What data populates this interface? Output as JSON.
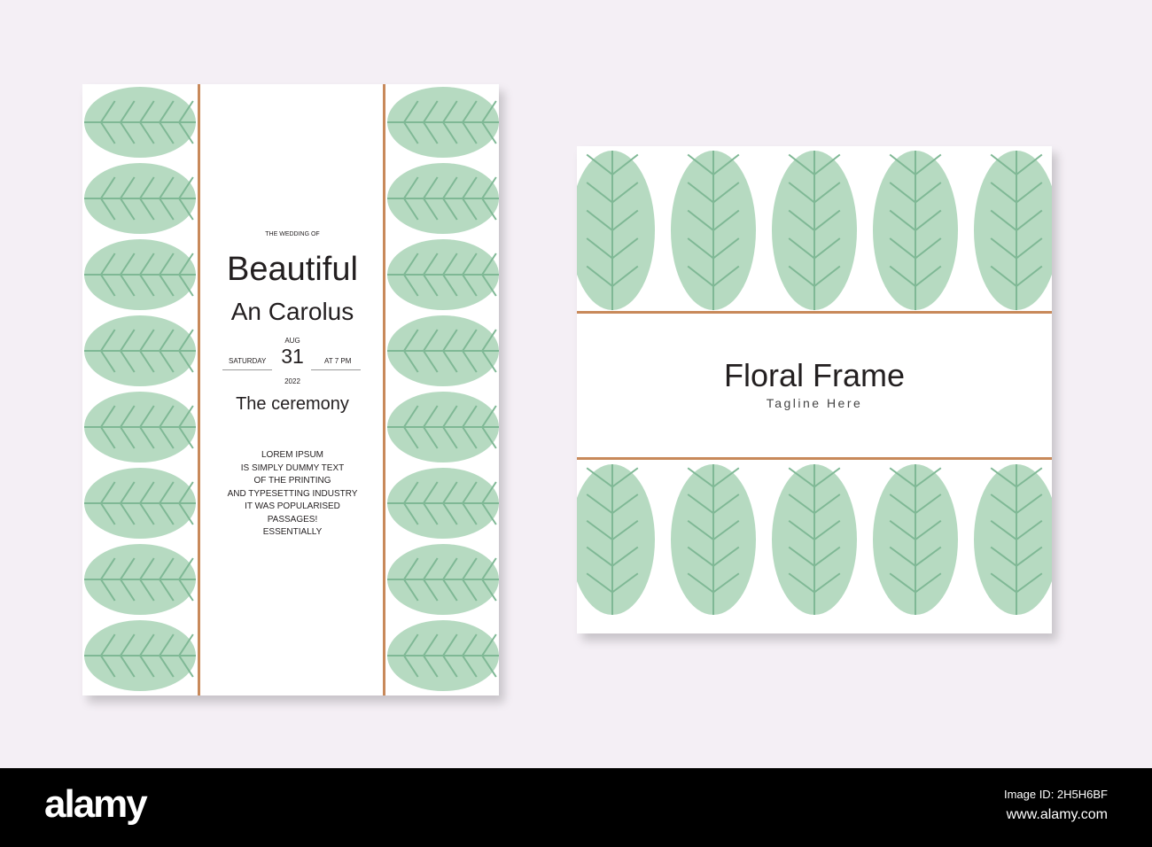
{
  "card1": {
    "subtitle": "THE WEDDING OF",
    "name1": "Beautiful",
    "name2": "An Carolus",
    "month": "AUG",
    "day": "31",
    "weekday": "SATURDAY",
    "time": "AT 7 PM",
    "year": "2022",
    "event": "The ceremony",
    "body": [
      "LOREM IPSUM",
      "IS SIMPLY DUMMY TEXT",
      "OF THE PRINTING",
      "AND TYPESETTING INDUSTRY",
      "IT WAS POPULARISED",
      "PASSAGES!",
      "ESSENTIALLY"
    ]
  },
  "card2": {
    "title": "Floral Frame",
    "tagline": "Tagline Here"
  },
  "footer": {
    "logo": "alamy",
    "image_id": "Image ID: 2H5H6BF",
    "url": "www.alamy.com"
  },
  "colors": {
    "leaf": "#a9d3b6",
    "vein": "#7fb895",
    "gold": "#c8895a",
    "background": "#f4eff5"
  }
}
